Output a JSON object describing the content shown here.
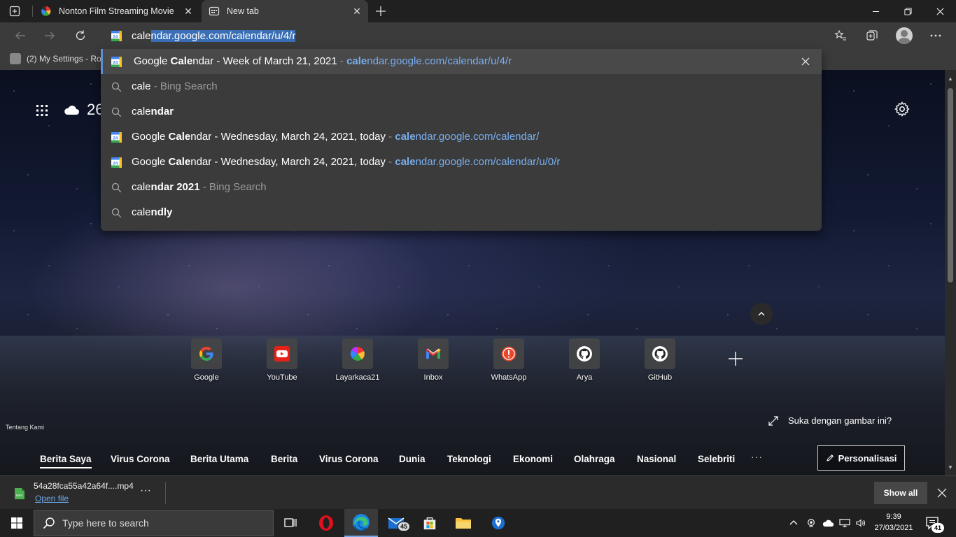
{
  "browser": {
    "tabs": [
      {
        "label": "Nonton Film Streaming Movie La",
        "active": false
      },
      {
        "label": "New tab",
        "active": true
      }
    ],
    "close_tab_glyph": "✕",
    "window_controls": {
      "minimize": "—",
      "maximize": "❐",
      "close": "✕"
    }
  },
  "favorites": {
    "items": [
      {
        "label": "(2) My Settings - Ro..."
      }
    ]
  },
  "omnibox": {
    "typed": "cale",
    "autocomplete": "ndar.google.com/calendar/u/4/r"
  },
  "suggestions": [
    {
      "type": "page",
      "pre": "Google ",
      "bold": "Cale",
      "post": "ndar - Week of March 21, 2021",
      "sep": " - ",
      "url_bold": "cale",
      "url_rest": "ndar.google.com/calendar/u/4/r"
    },
    {
      "type": "search",
      "bold": "",
      "plain": "cale",
      "suffix": " - Bing Search"
    },
    {
      "type": "search",
      "plain": "cale",
      "bold": "ndar",
      "suffix": ""
    },
    {
      "type": "page",
      "pre": "Google ",
      "bold": "Cale",
      "post": "ndar - Wednesday, March 24, 2021, today",
      "sep": " - ",
      "url_bold": "cale",
      "url_rest": "ndar.google.com/calendar/"
    },
    {
      "type": "page",
      "pre": "Google ",
      "bold": "Cale",
      "post": "ndar - Wednesday, March 24, 2021, today",
      "sep": " - ",
      "url_bold": "cale",
      "url_rest": "ndar.google.com/calendar/u/0/r"
    },
    {
      "type": "search",
      "plain": "cale",
      "bold": "ndar 2021",
      "suffix": " - Bing Search"
    },
    {
      "type": "search",
      "plain": "cale",
      "bold": "ndly",
      "suffix": ""
    }
  ],
  "ntp": {
    "weather_temp": "26",
    "quick_links": [
      {
        "label": "Google",
        "icon": "google-icon"
      },
      {
        "label": "YouTube",
        "icon": "youtube-icon"
      },
      {
        "label": "Layarkaca21",
        "icon": "layarkaca-icon"
      },
      {
        "label": "Inbox",
        "icon": "gmail-icon"
      },
      {
        "label": "WhatsApp",
        "icon": "whatsapp-icon"
      },
      {
        "label": "Arya",
        "icon": "github-icon"
      },
      {
        "label": "GitHub",
        "icon": "github-icon"
      }
    ],
    "about": "Tentang Kami",
    "like_image": "Suka dengan gambar ini?",
    "news_nav": [
      "Berita Saya",
      "Virus Corona",
      "Berita Utama",
      "Berita",
      "Virus Corona",
      "Dunia",
      "Teknologi",
      "Ekonomi",
      "Olahraga",
      "Nasional",
      "Selebriti"
    ],
    "more": "···",
    "personalize": "Personalisasi"
  },
  "download": {
    "filename": "54a28fca55a42a64f....mp4",
    "open_file": "Open file",
    "more": "···",
    "show_all": "Show all",
    "file_badge": "MP4"
  },
  "taskbar": {
    "search_placeholder": "Type here to search",
    "mail_badge": "45",
    "time": "9:39",
    "date": "27/03/2021",
    "notifications": "41"
  },
  "colors": {
    "accent": "#5c8fd6",
    "link": "#79aef0",
    "chrome_bg": "#3b3b3b",
    "tabbar_bg": "#202020"
  }
}
